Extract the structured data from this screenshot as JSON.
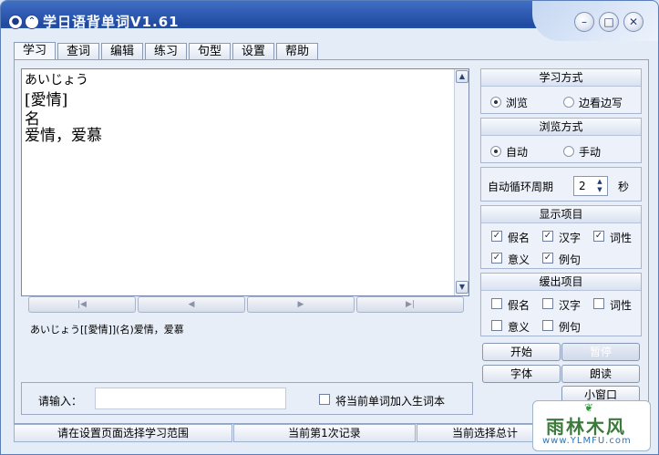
{
  "window": {
    "title": "学日语背单词V1.61"
  },
  "tabs": [
    "学习",
    "查词",
    "编辑",
    "练习",
    "句型",
    "设置",
    "帮助"
  ],
  "display": {
    "kana": "あいじょう",
    "kanji": "[愛情]",
    "pos": "名",
    "meaning": "爱情，爱慕"
  },
  "nav": [
    "|◀",
    "◀",
    "▶",
    "▶|"
  ],
  "summary": "あいじょう[[愛情]](名)爱情，爱慕",
  "input": {
    "label": "请输入：",
    "value": "",
    "add_label": "将当前单词加入生词本"
  },
  "study_mode": {
    "title": "学习方式",
    "options": [
      "浏览",
      "边看边写"
    ],
    "selected": 0
  },
  "browse_mode": {
    "title": "浏览方式",
    "options": [
      "自动",
      "手动"
    ],
    "selected": 0
  },
  "cycle": {
    "label": "自动循环周期",
    "value": "2",
    "unit": "秒"
  },
  "show_items": {
    "title": "显示项目",
    "items": [
      "假名",
      "汉字",
      "词性",
      "意义",
      "例句"
    ],
    "checked": [
      true,
      true,
      true,
      true,
      true
    ]
  },
  "delay_items": {
    "title": "缓出项目",
    "items": [
      "假名",
      "汉字",
      "词性",
      "意义",
      "例句"
    ],
    "checked": [
      false,
      false,
      false,
      false,
      false
    ]
  },
  "buttons": {
    "start": "开始",
    "pause": "暂停",
    "font": "字体",
    "read": "朗读",
    "mini": "小窗口"
  },
  "status": [
    "请在设置页面选择学习范围",
    "当前第1次记录",
    "当前选择总计"
  ],
  "logo": {
    "text": "雨林木风",
    "url": "www.YLMFU.com"
  }
}
